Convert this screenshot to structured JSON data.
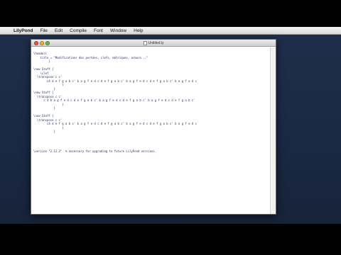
{
  "menubar": {
    "apple_glyph": "",
    "items": [
      "LilyPond",
      "File",
      "Edit",
      "Compile",
      "Font",
      "Window",
      "Help"
    ]
  },
  "window": {
    "title": "Untitled.ly"
  },
  "editor": {
    "lines": [
      "\\header{",
      "    title = \"Modifications des portées, clefs, métriques, armure...\"",
      "         }",
      "",
      "\\new Staff {",
      "    \\clef",
      "  \\transpose c c'",
      "        c4 d e f g a b c' b a g f e d c d e f g a b c' b a g f e d c d e f g a b c' b a g f e d c",
      "                 }",
      "            }",
      "\\new Staff {",
      "  \\transpose c c'",
      "      c'4 b a g f e d c d e f g a b c' b a g f e d c d e f g a b c' b a g f e d c d e f g a b c'",
      "                 }",
      "            }",
      "",
      "\\new Staff {",
      "  \\transpose c c'",
      "        c4 d e f g a b c' b a g f e d c d e f g a b c' b a g f e d c d e f g a b c' b a g f e d c",
      "                 }",
      "            }",
      "",
      "",
      "",
      "",
      "\\version \"2.12.3\"  % necessary for upgrading to future LilyPond versions."
    ]
  },
  "colors": {
    "code_text": "#1e2a55",
    "desktop": "#1c2a44",
    "window_bg": "#ffffff"
  }
}
